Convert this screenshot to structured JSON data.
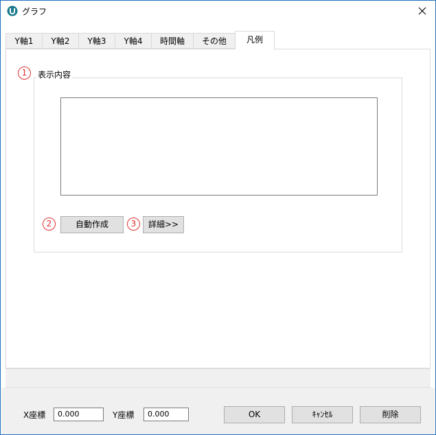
{
  "window": {
    "title": "グラフ"
  },
  "tabs": [
    {
      "label": "Y軸1"
    },
    {
      "label": "Y軸2"
    },
    {
      "label": "Y軸3"
    },
    {
      "label": "Y軸4"
    },
    {
      "label": "時間軸"
    },
    {
      "label": "その他"
    },
    {
      "label": "凡例",
      "active": true
    }
  ],
  "legend_group": {
    "label": "表示内容",
    "content": "",
    "auto_create_label": "自動作成",
    "details_label": "詳細>>"
  },
  "markers": [
    "1",
    "2",
    "3"
  ],
  "coords": {
    "x_label": "X座標",
    "x_value": "0.000",
    "y_label": "Y座標",
    "y_value": "0.000"
  },
  "buttons": {
    "ok": "OK",
    "cancel": "ｷｬﾝｾﾙ",
    "delete": "削除"
  },
  "colors": {
    "annotation": "#e03030",
    "window_border": "#1f6fbf",
    "app_icon": "#1a7a8c"
  },
  "icons": {
    "app": "app-logo-icon",
    "close": "close-icon"
  }
}
